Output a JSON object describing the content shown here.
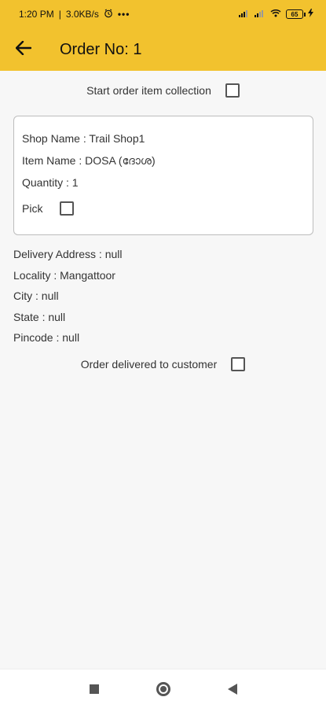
{
  "status": {
    "time": "1:20 PM",
    "speed": "3.0KB/s",
    "dots": "•••",
    "battery": "65"
  },
  "appbar": {
    "title": "Order No: 1",
    "back_icon": "arrow-left-icon"
  },
  "collection": {
    "label": "Start order item collection",
    "checked": false
  },
  "item": {
    "shop": "Shop Name : Trail Shop1",
    "name": "Item Name : DOSA (ദോശ)",
    "quantity": "Quantity :  1",
    "pick_label": "Pick",
    "pick_checked": false
  },
  "address": {
    "delivery": "Delivery Address : null",
    "locality": "Locality : Mangattoor",
    "city": "City : null",
    "state": "State : null",
    "pincode": "Pincode : null"
  },
  "delivered": {
    "label": "Order delivered to customer",
    "checked": false
  },
  "colors": {
    "accent": "#f2c22e"
  }
}
